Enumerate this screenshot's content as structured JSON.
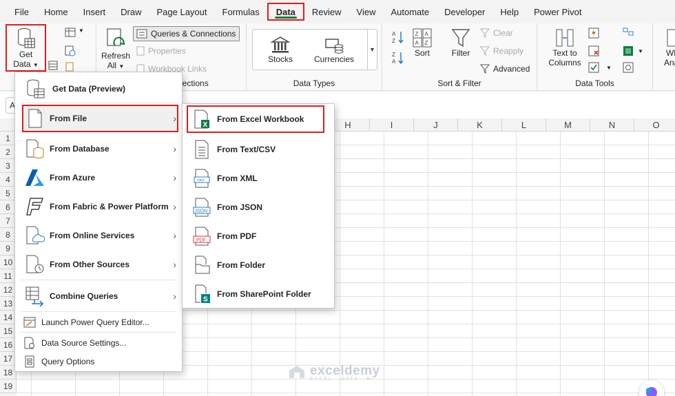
{
  "menubar": {
    "tabs": [
      "File",
      "Home",
      "Insert",
      "Draw",
      "Page Layout",
      "Formulas",
      "Data",
      "Review",
      "View",
      "Automate",
      "Developer",
      "Help",
      "Power Pivot"
    ],
    "active_tab": "Data"
  },
  "ribbon": {
    "get_data": {
      "line1": "Get",
      "line2": "Data"
    },
    "refresh": {
      "line1": "Refresh",
      "line2": "All"
    },
    "queries_connections": "Queries & Connections",
    "properties": "Properties",
    "workbook_links": "Workbook Links",
    "group_queries_label": "nections",
    "data_types": {
      "stocks": "Stocks",
      "currencies": "Currencies",
      "label": "Data Types"
    },
    "sort_filter": {
      "sort": "Sort",
      "filter": "Filter",
      "clear": "Clear",
      "reapply": "Reapply",
      "advanced": "Advanced",
      "label": "Sort & Filter"
    },
    "data_tools": {
      "text_to_columns_line1": "Text to",
      "text_to_columns_line2": "Columns",
      "label": "Data Tools"
    },
    "whatif": {
      "line1": "Wh",
      "line2": "Anal"
    }
  },
  "formulabar": {
    "namebox": "A"
  },
  "columns": [
    "H",
    "I",
    "J",
    "K",
    "L",
    "M",
    "N",
    "O"
  ],
  "rows": [
    "1",
    "2",
    "3",
    "4",
    "5",
    "6",
    "7",
    "8",
    "9",
    "10",
    "11",
    "12",
    "13",
    "14",
    "15",
    "16",
    "17",
    "18",
    "19"
  ],
  "menu1": {
    "items": [
      {
        "label": "Get Data (Preview)",
        "icon": "get-data-icon"
      },
      {
        "label": "From File",
        "icon": "file-icon",
        "submenu": true
      },
      {
        "label": "From Database",
        "icon": "database-icon",
        "submenu": true
      },
      {
        "label": "From Azure",
        "icon": "azure-icon",
        "submenu": true
      },
      {
        "label": "From Fabric & Power Platform",
        "icon": "fabric-icon",
        "submenu": true
      },
      {
        "label": "From Online Services",
        "icon": "cloud-icon",
        "submenu": true
      },
      {
        "label": "From Other Sources",
        "icon": "other-sources-icon",
        "submenu": true
      },
      {
        "label": "Combine Queries",
        "icon": "combine-icon",
        "submenu": true
      },
      {
        "label": "Launch Power Query Editor...",
        "icon": "power-query-icon"
      },
      {
        "label": "Data Source Settings...",
        "icon": "data-source-icon"
      },
      {
        "label": "Query Options",
        "icon": "query-options-icon"
      }
    ]
  },
  "menu2": {
    "items": [
      {
        "label": "From Excel Workbook",
        "icon": "excel-workbook-icon"
      },
      {
        "label": "From Text/CSV",
        "icon": "text-csv-icon"
      },
      {
        "label": "From XML",
        "icon": "xml-icon"
      },
      {
        "label": "From JSON",
        "icon": "json-icon"
      },
      {
        "label": "From PDF",
        "icon": "pdf-icon"
      },
      {
        "label": "From Folder",
        "icon": "folder-icon"
      },
      {
        "label": "From SharePoint Folder",
        "icon": "sharepoint-icon"
      }
    ]
  },
  "watermark": {
    "name": "exceldemy",
    "sub": "EXCEL · DATA · BI"
  },
  "colors": {
    "accent": "#107c41",
    "highlight": "#e01c1c"
  }
}
